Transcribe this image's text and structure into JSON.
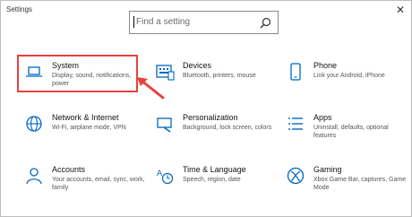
{
  "window": {
    "title": "Settings",
    "close_glyph": "✕"
  },
  "search": {
    "placeholder": "Find a setting",
    "icon": "search-icon"
  },
  "categories": [
    {
      "name": "System",
      "desc": "Display, sound, notifications, power",
      "icon": "laptop-icon"
    },
    {
      "name": "Devices",
      "desc": "Bluetooth, printers, mouse",
      "icon": "keyboard-icon"
    },
    {
      "name": "Phone",
      "desc": "Link your Android, iPhone",
      "icon": "phone-icon"
    },
    {
      "name": "Network & Internet",
      "desc": "Wi-Fi, airplane mode, VPN",
      "icon": "globe-icon"
    },
    {
      "name": "Personalization",
      "desc": "Background, lock screen, colors",
      "icon": "brush-icon"
    },
    {
      "name": "Apps",
      "desc": "Uninstall, defaults, optional features",
      "icon": "apps-icon"
    },
    {
      "name": "Accounts",
      "desc": "Your accounts, email, sync, work, family",
      "icon": "person-icon"
    },
    {
      "name": "Time & Language",
      "desc": "Speech, region, date",
      "icon": "time-language-icon"
    },
    {
      "name": "Gaming",
      "desc": "Xbox Game Bar, captures, Game Mode",
      "icon": "xbox-icon"
    }
  ],
  "colors": {
    "highlight": "#e8413d",
    "accent": "#0067c0"
  }
}
